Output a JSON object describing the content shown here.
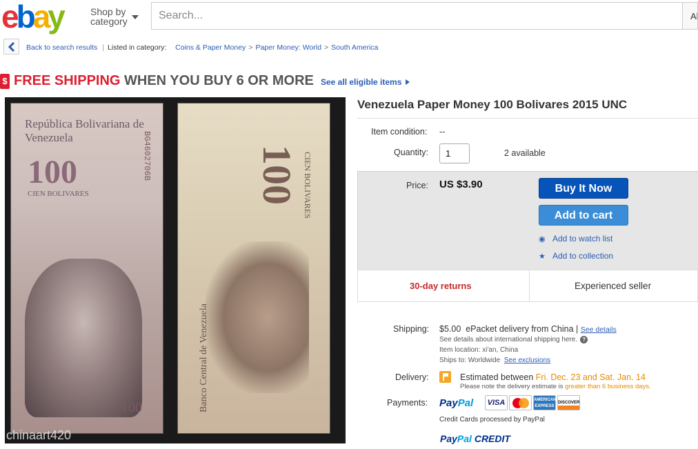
{
  "header": {
    "logo_letters": [
      "e",
      "b",
      "a",
      "y"
    ],
    "logo_colors": [
      "#e53238",
      "#0064d2",
      "#f5af02",
      "#86b817"
    ],
    "shop_by_line1": "Shop by",
    "shop_by_line2": "category",
    "search_placeholder": "Search...",
    "search_side_text": "Al"
  },
  "breadcrumb": {
    "back_label": "Back to search results",
    "listed_label": "Listed in category:",
    "items": [
      "Coins & Paper Money",
      "Paper Money: World",
      "South America"
    ],
    "separator": ">"
  },
  "promo": {
    "icon_text": "$",
    "free_shipping": "FREE SHIPPING",
    "condition": "WHEN YOU BUY 6 OR MORE",
    "link": "See all eligible items"
  },
  "image": {
    "front_text": "República Bolivariana de Venezuela",
    "front_denomination": "100",
    "front_words": "CIEN BOLIVARES",
    "serial": "BG4602706B",
    "back_denomination": "100",
    "back_words": "CIEN BOLIVARES",
    "back_bank": "Banco Central de Venezuela",
    "watermark": "chinaart420"
  },
  "item": {
    "title": "Venezuela Paper Money 100 Bolivares 2015 UNC",
    "condition_label": "Item condition:",
    "condition_value": "--",
    "quantity_label": "Quantity:",
    "quantity_value": "1",
    "available": "2 available",
    "price_label": "Price:",
    "price": "US $3.90",
    "buy_now": "Buy It Now",
    "add_to_cart": "Add to cart",
    "watch": "Add to watch list",
    "collection": "Add to collection",
    "returns": "30-day returns",
    "seller": "Experienced seller"
  },
  "shipping": {
    "label": "Shipping:",
    "price": "$5.00",
    "method": "ePacket delivery from China |",
    "details_link": "See details",
    "intl_note": "See details about international shipping here.",
    "item_location": "Item location:  xi'an, China",
    "ships_to_label": "Ships to:  Worldwide",
    "exclusions_link": "See exclusions"
  },
  "delivery": {
    "label": "Delivery:",
    "prefix": "Estimated between",
    "range": "Fri. Dec. 23 and Sat. Jan. 14",
    "note_prefix": "Please note the delivery estimate is",
    "note_highlight": "greater than 6 business days."
  },
  "payments": {
    "label": "Payments:",
    "paypal_pay": "Pay",
    "paypal_pal": "Pal",
    "cards": [
      "VISA",
      "MasterCard",
      "AMERICAN EXPRESS",
      "DISCOVER"
    ],
    "processed": "Credit Cards processed by PayPal",
    "credit": "CREDIT"
  }
}
